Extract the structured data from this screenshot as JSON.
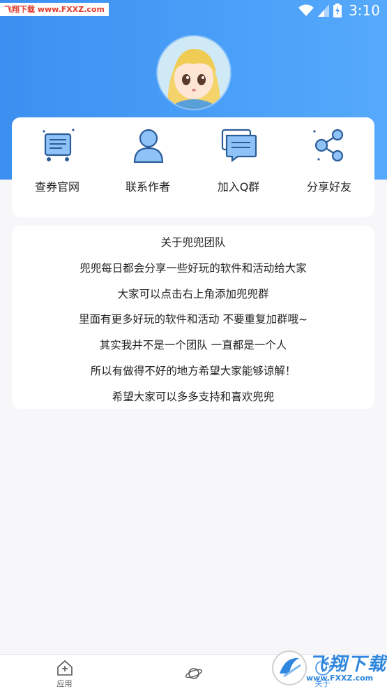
{
  "status_bar": {
    "watermark": "飞翔下载 www.FXXZ.com",
    "time": "3:10"
  },
  "actions": [
    {
      "label": "查券官网",
      "icon": "cart-icon"
    },
    {
      "label": "联系作者",
      "icon": "person-icon"
    },
    {
      "label": "加入Q群",
      "icon": "chat-icon"
    },
    {
      "label": "分享好友",
      "icon": "share-icon"
    }
  ],
  "about": {
    "title": "关于兜兜团队",
    "lines": [
      "兜兜每日都会分享一些好玩的软件和活动给大家",
      "大家可以点击右上角添加兜兜群",
      "里面有更多好玩的软件和活动 不要重复加群哦~",
      "其实我并不是一个团队 一直都是一个人",
      "所以有做得不好的地方希望大家能够谅解！",
      "希望大家可以多多支持和喜欢兜兜"
    ]
  },
  "bottom_nav": [
    {
      "label": "应用",
      "icon": "home-plus-icon"
    },
    {
      "label": "",
      "icon": "planet-icon"
    },
    {
      "label": "关于",
      "icon": "info-icon"
    }
  ],
  "watermark_bottom": {
    "title": "飞翔下载",
    "url": "www.FXXZ.com"
  },
  "colors": {
    "accent": "#3c8ff0",
    "icon_fill": "#8fc3f7",
    "icon_stroke": "#2b5c9a"
  }
}
